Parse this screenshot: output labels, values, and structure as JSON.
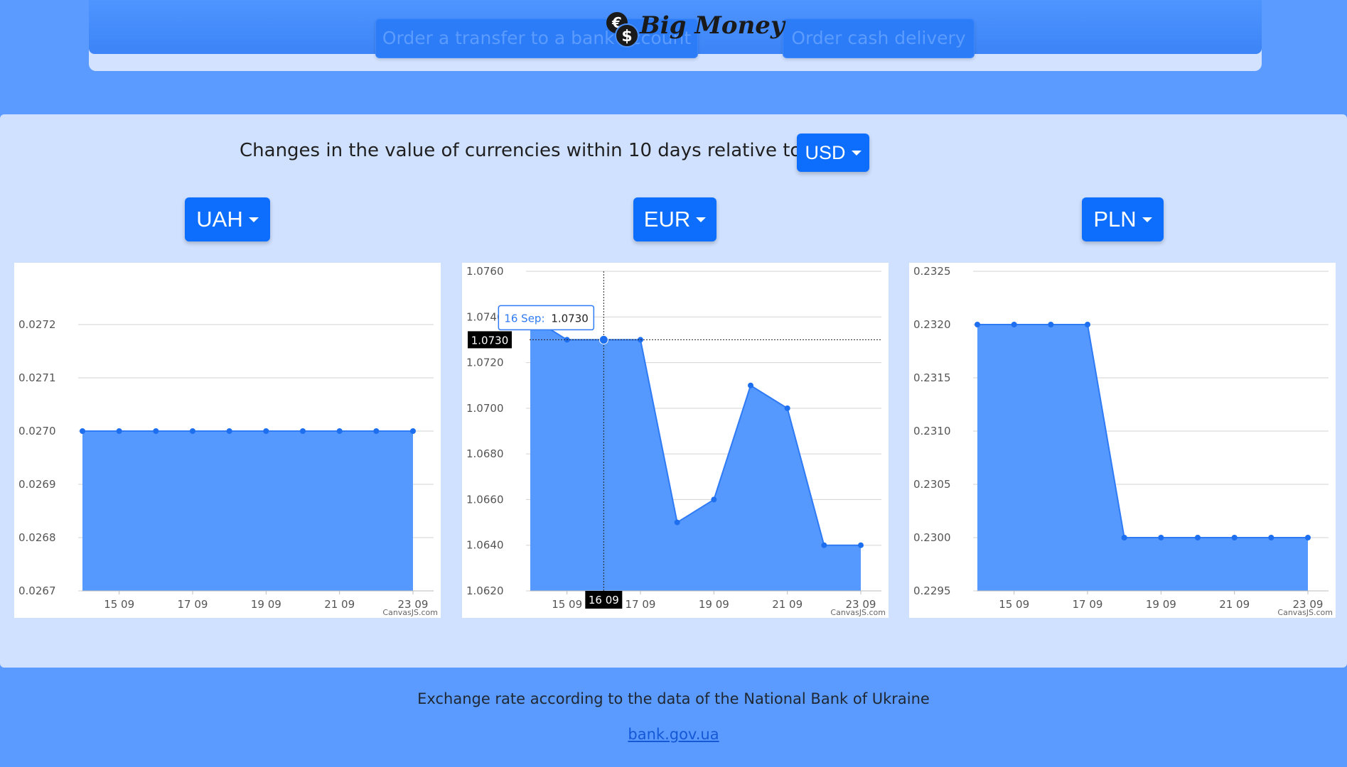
{
  "header": {
    "brand_name": "Big Money",
    "brand_icon": "coins-icon",
    "order_transfer_label": "Order a transfer to a bank account",
    "order_cash_label": "Order cash delivery"
  },
  "main": {
    "changes_label": "Changes in the value of currencies within 10 days relative to:",
    "base_currency": "USD"
  },
  "charts": [
    {
      "currency": "UAH",
      "watermark": "CanvasJS.com"
    },
    {
      "currency": "EUR",
      "watermark": "CanvasJS.com",
      "tooltip": {
        "label": "16 Sep:",
        "value": "1.0730"
      },
      "crosshair": {
        "x_label": "16 09",
        "y_label": "1.0730"
      }
    },
    {
      "currency": "PLN",
      "watermark": "CanvasJS.com"
    }
  ],
  "chart_data": [
    {
      "type": "area",
      "title": "UAH",
      "x": [
        "14 09",
        "15 09",
        "16 09",
        "17 09",
        "18 09",
        "19 09",
        "20 09",
        "21 09",
        "22 09",
        "23 09"
      ],
      "values": [
        0.027,
        0.027,
        0.027,
        0.027,
        0.027,
        0.027,
        0.027,
        0.027,
        0.027,
        0.027
      ],
      "x_ticks": [
        "15 09",
        "17 09",
        "19 09",
        "21 09",
        "23 09"
      ],
      "y_ticks": [
        "0.0267",
        "0.0268",
        "0.0269",
        "0.0270",
        "0.0271",
        "0.0272"
      ],
      "ylim": [
        0.0267,
        0.0273
      ],
      "grid": true,
      "color": "#2f7af5",
      "fill_color": "#5599ff"
    },
    {
      "type": "area",
      "title": "EUR",
      "x": [
        "14 09",
        "15 09",
        "16 09",
        "17 09",
        "18 09",
        "19 09",
        "20 09",
        "21 09",
        "22 09",
        "23 09"
      ],
      "values": [
        1.074,
        1.073,
        1.073,
        1.073,
        1.065,
        1.066,
        1.071,
        1.07,
        1.064,
        1.064
      ],
      "x_ticks": [
        "15 09",
        "17 09",
        "19 09",
        "21 09",
        "23 09"
      ],
      "y_ticks": [
        "1.0620",
        "1.0640",
        "1.0660",
        "1.0680",
        "1.0700",
        "1.0720",
        "1.0740",
        "1.0760"
      ],
      "ylim": [
        1.062,
        1.076
      ],
      "grid": true,
      "color": "#2f7af5",
      "fill_color": "#5599ff"
    },
    {
      "type": "area",
      "title": "PLN",
      "x": [
        "14 09",
        "15 09",
        "16 09",
        "17 09",
        "18 09",
        "19 09",
        "20 09",
        "21 09",
        "22 09",
        "23 09"
      ],
      "values": [
        0.232,
        0.232,
        0.232,
        0.232,
        0.23,
        0.23,
        0.23,
        0.23,
        0.23,
        0.23
      ],
      "x_ticks": [
        "15 09",
        "17 09",
        "19 09",
        "21 09",
        "23 09"
      ],
      "y_ticks": [
        "0.2295",
        "0.2300",
        "0.2305",
        "0.2310",
        "0.2315",
        "0.2320",
        "0.2325"
      ],
      "ylim": [
        0.2295,
        0.2325
      ],
      "grid": true,
      "color": "#2f7af5",
      "fill_color": "#5599ff"
    }
  ],
  "footer": {
    "source_text": "Exchange rate according to the data of the National Bank of Ukraine",
    "link_text": "bank.gov.ua"
  }
}
